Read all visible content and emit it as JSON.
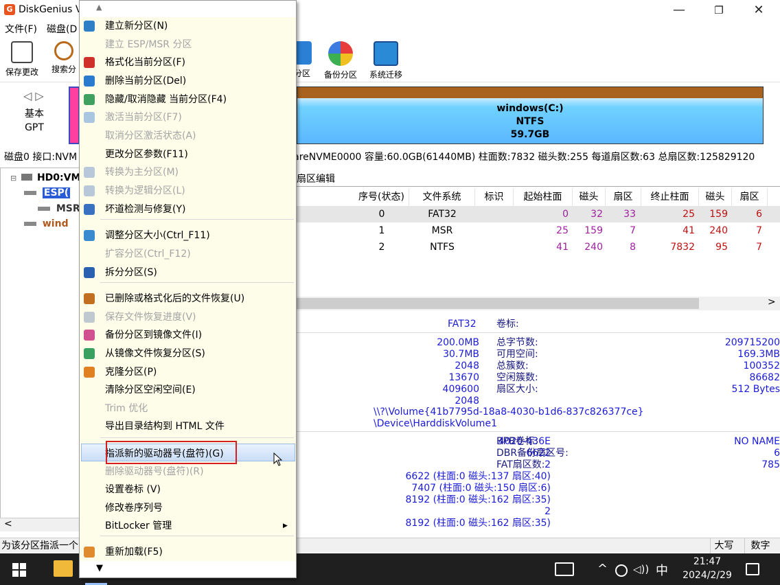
{
  "window": {
    "app_icon_letter": "G",
    "title": "DiskGenius V",
    "min_symbol": "—",
    "max_symbol": "❐",
    "close_symbol": "✕"
  },
  "menubar": {
    "items": [
      "文件(F)",
      "磁盘(D"
    ]
  },
  "toolbar": {
    "buttons": [
      {
        "label": "保存更改",
        "icon": "save-icon"
      },
      {
        "label": "搜索分",
        "icon": "search-icon"
      },
      {
        "label": "分区",
        "icon": "delete-partition-icon"
      },
      {
        "label": "备份分区",
        "icon": "backup-icon"
      },
      {
        "label": "系统迁移",
        "icon": "migrate-icon"
      }
    ]
  },
  "diskmap": {
    "nav": "◁ ▷",
    "disk_type_line1": "基本",
    "disk_type_line2": "GPT",
    "partition_name": "windows(C:)",
    "partition_fs": "NTFS",
    "partition_size": "59.7GB"
  },
  "disk_info_prefix": "磁盘0 接口:NVM",
  "disk_info": "WareNVME0000  容量:60.0GB(61440MB)  柱面数:7832  磁头数:255  每道扇区数:63  总扇区数:125829120",
  "tree": {
    "root": "HD0:VM",
    "items": [
      {
        "label": "ESP(",
        "color": "#1f3fb0",
        "selected": true
      },
      {
        "label": "MSR(",
        "color": "#333333",
        "selected": false
      },
      {
        "label": "wind",
        "color": "#b05a1e",
        "selected": false
      }
    ],
    "scroll_left": "<"
  },
  "tab_label": "扇区编辑",
  "grid": {
    "headers": [
      "序号(状态)",
      "文件系统",
      "标识",
      "起始柱面",
      "磁头",
      "扇区",
      "终止柱面",
      "磁头",
      "扇区"
    ],
    "rows": [
      [
        "0",
        "FAT32",
        "",
        "0",
        "32",
        "33",
        "25",
        "159",
        "6"
      ],
      [
        "1",
        "MSR",
        "",
        "25",
        "159",
        "7",
        "41",
        "240",
        "7"
      ],
      [
        "2",
        "NTFS",
        "",
        "41",
        "240",
        "8",
        "7832",
        "95",
        "7"
      ]
    ],
    "scroll_right": ">"
  },
  "info": {
    "fs_value": "FAT32",
    "volume_label_key": "卷标:",
    "left_values": [
      "200.0MB",
      "30.7MB",
      "2048",
      "13670",
      "409600",
      "2048"
    ],
    "right_keys": [
      "总字节数:",
      "可用空间:",
      "总簇数:",
      "空闲簇数:",
      "扇区大小:"
    ],
    "right_values": [
      "209715200",
      "169.3MB",
      "100352",
      "86682",
      "512 Bytes"
    ],
    "volume_path": "\\\\?\\Volume{41b7795d-18a8-4030-b1d6-837c826377ce}",
    "device_path": "\\Device\\HarddiskVolume1",
    "bpb_left": [
      "4020-436E",
      "6622",
      "2",
      "6622 (柱面:0 磁头:137 扇区:40)",
      "7407 (柱面:0 磁头:150 扇区:6)",
      "8192 (柱面:0 磁头:162 扇区:35)",
      "2",
      "8192 (柱面:0 磁头:162 扇区:35)"
    ],
    "bpb_keys": [
      "BPB卷标:",
      "DBR备份扇区号:",
      "FAT扇区数:"
    ],
    "bpb_values": [
      "NO NAME",
      "6",
      "785"
    ]
  },
  "status": {
    "text": "为该分区指派一个",
    "caps": "大写",
    "num": "数字"
  },
  "taskbar": {
    "ime": "中",
    "time": "21:47",
    "date": "2024/2/29"
  },
  "context_menu": {
    "scroll_up": "▲",
    "scroll_down": "▼",
    "items": [
      {
        "label": "建立新分区(N)",
        "disabled": false,
        "icon": "new-partition-icon",
        "color": "#2f7fc6"
      },
      {
        "label": "建立 ESP/MSR 分区",
        "disabled": true,
        "icon": "",
        "color": ""
      },
      {
        "label": "格式化当前分区(F)",
        "disabled": false,
        "icon": "format-icon",
        "color": "#d0302a"
      },
      {
        "label": "删除当前分区(Del)",
        "disabled": false,
        "icon": "trash-icon",
        "color": "#2a7ad0"
      },
      {
        "label": "隐藏/取消隐藏 当前分区(F4)",
        "disabled": false,
        "icon": "hide-icon",
        "color": "#3fa060"
      },
      {
        "label": "激活当前分区(F7)",
        "disabled": true,
        "icon": "activate-icon",
        "color": "#a9c5e0"
      },
      {
        "label": "取消分区激活状态(A)",
        "disabled": true,
        "icon": "",
        "color": ""
      },
      {
        "label": "更改分区参数(F11)",
        "disabled": false,
        "icon": "",
        "color": ""
      },
      {
        "label": "转换为主分区(M)",
        "disabled": true,
        "icon": "convert-primary-icon",
        "color": "#b8c8d8"
      },
      {
        "label": "转换为逻辑分区(L)",
        "disabled": true,
        "icon": "convert-logical-icon",
        "color": "#b8c8d8"
      },
      {
        "label": "坏道检测与修复(Y)",
        "disabled": false,
        "icon": "repair-icon",
        "color": "#3a70c0"
      },
      {
        "label": "调整分区大小(Ctrl_F11)",
        "disabled": false,
        "icon": "resize-icon",
        "color": "#3a8ad0"
      },
      {
        "label": "扩容分区(Ctrl_F12)",
        "disabled": true,
        "icon": "",
        "color": ""
      },
      {
        "label": "拆分分区(S)",
        "disabled": false,
        "icon": "split-icon",
        "color": "#2a60b0"
      },
      {
        "label": "已删除或格式化后的文件恢复(U)",
        "disabled": false,
        "icon": "recover-icon",
        "color": "#c07020"
      },
      {
        "label": "保存文件恢复进度(V)",
        "disabled": true,
        "icon": "save-progress-icon",
        "color": "#c0c8d0"
      },
      {
        "label": "备份分区到镜像文件(I)",
        "disabled": false,
        "icon": "backup-image-icon",
        "color": "#d05090"
      },
      {
        "label": "从镜像文件恢复分区(S)",
        "disabled": false,
        "icon": "restore-image-icon",
        "color": "#3aa060"
      },
      {
        "label": "克隆分区(P)",
        "disabled": false,
        "icon": "clone-icon",
        "color": "#e08020"
      },
      {
        "label": "清除分区空闲空间(E)",
        "disabled": false,
        "icon": "",
        "color": ""
      },
      {
        "label": "Trim 优化",
        "disabled": true,
        "icon": "",
        "color": ""
      },
      {
        "label": "导出目录结构到 HTML 文件",
        "disabled": false,
        "icon": "",
        "color": ""
      },
      {
        "label": "指派新的驱动器号(盘符)(G)",
        "disabled": false,
        "icon": "",
        "color": ""
      },
      {
        "label": "删除驱动器号(盘符)(R)",
        "disabled": true,
        "icon": "",
        "color": ""
      },
      {
        "label": "设置卷标 (V)",
        "disabled": false,
        "icon": "",
        "color": ""
      },
      {
        "label": "修改卷序列号",
        "disabled": false,
        "icon": "",
        "color": ""
      },
      {
        "label": "BitLocker 管理",
        "disabled": false,
        "icon": "",
        "color": ""
      },
      {
        "label": "重新加载(F5)",
        "disabled": false,
        "icon": "reload-icon",
        "color": "#e08a30"
      }
    ],
    "submenu_arrow": "▶"
  }
}
